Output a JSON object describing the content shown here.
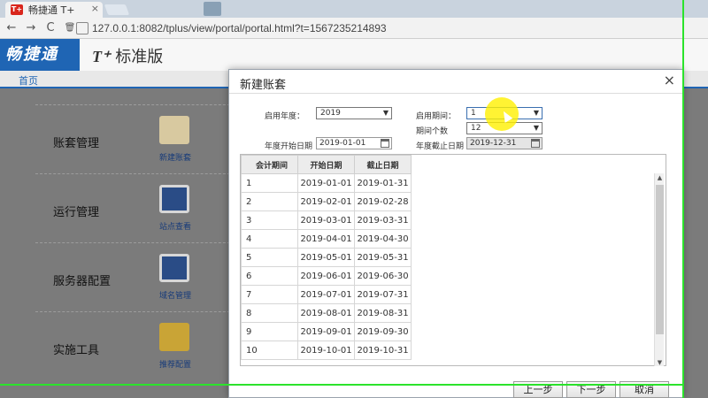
{
  "browser": {
    "tab_title": "畅捷通 T+",
    "favicon_text": "T+",
    "tab_close": "×",
    "url": "127.0.0.1:8082/tplus/view/portal/portal.html?t=1567235214893",
    "nav_back": "←",
    "nav_forward": "→",
    "nav_reload": "C",
    "nav_delete": "🗑"
  },
  "app": {
    "logo": "畅捷通",
    "product_prefix": "T⁺",
    "product_name": "标准版",
    "home_tab": "首页"
  },
  "sections": [
    {
      "title": "账套管理",
      "link": "新建账套",
      "icon": "account-book-icon"
    },
    {
      "title": "运行管理",
      "link": "站点查看",
      "icon": "monitor-icon"
    },
    {
      "title": "服务器配置",
      "link": "域名管理",
      "icon": "monitor-icon"
    },
    {
      "title": "实施工具",
      "link": "推荐配置",
      "icon": "gear-doc-icon"
    }
  ],
  "modal": {
    "title": "新建账套",
    "close": "×",
    "fields": {
      "enable_year_label": "启用年度：",
      "enable_year_value": "2019",
      "enable_period_label": "启用期间：",
      "enable_period_value": "1",
      "period_count_label": "期间个数",
      "period_count_value": "12",
      "year_start_label": "年度开始日期",
      "year_start_value": "2019-01-01",
      "year_end_label": "年度截止日期",
      "year_end_value": "2019-12-31"
    },
    "table": {
      "headers": [
        "会计期间",
        "开始日期",
        "截止日期"
      ],
      "rows": [
        [
          "1",
          "2019-01-01",
          "2019-01-31"
        ],
        [
          "2",
          "2019-02-01",
          "2019-02-28"
        ],
        [
          "3",
          "2019-03-01",
          "2019-03-31"
        ],
        [
          "4",
          "2019-04-01",
          "2019-04-30"
        ],
        [
          "5",
          "2019-05-01",
          "2019-05-31"
        ],
        [
          "6",
          "2019-06-01",
          "2019-06-30"
        ],
        [
          "7",
          "2019-07-01",
          "2019-07-31"
        ],
        [
          "8",
          "2019-08-01",
          "2019-08-31"
        ],
        [
          "9",
          "2019-09-01",
          "2019-09-30"
        ],
        [
          "10",
          "2019-10-01",
          "2019-10-31"
        ]
      ]
    },
    "buttons": {
      "prev": "上一步",
      "next": "下一步",
      "cancel": "取消"
    }
  },
  "colors": {
    "brand_blue": "#1f65b4",
    "recording_frame": "#2be32b",
    "cursor_highlight": "#fff000"
  }
}
